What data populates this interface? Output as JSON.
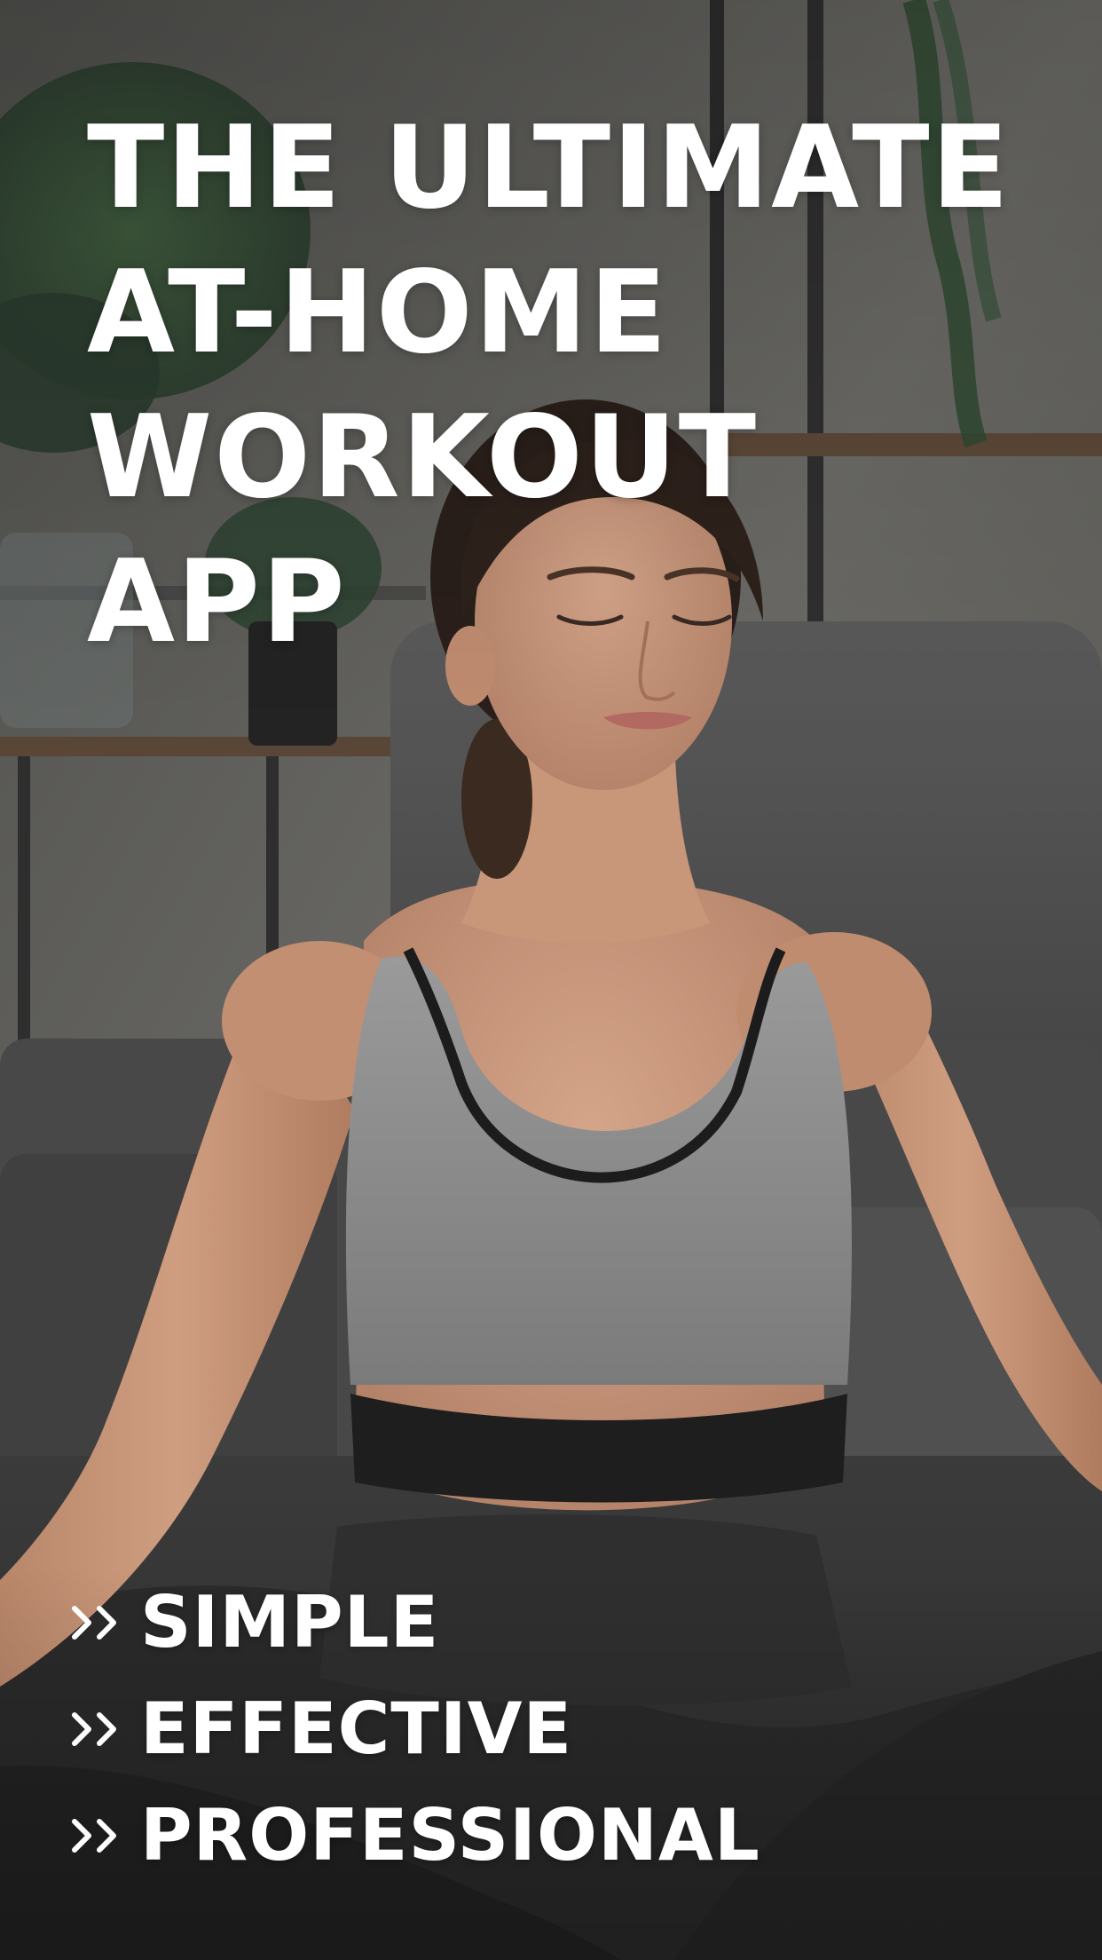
{
  "headline": {
    "lines": [
      "THE ULTIMATE",
      "AT-HOME",
      "WORKOUT",
      "APP"
    ]
  },
  "features": [
    {
      "icon": "double-chevron-right-icon",
      "label": "SIMPLE"
    },
    {
      "icon": "double-chevron-right-icon",
      "label": "EFFECTIVE"
    },
    {
      "icon": "double-chevron-right-icon",
      "label": "PROFESSIONAL"
    }
  ],
  "colors": {
    "text": "#ffffff",
    "wall": "#5f5e5b",
    "sofa": "#4d4d4d",
    "skin": "#c08e74",
    "top": "#8a8a8a",
    "leggings": "#2b2b2b"
  }
}
